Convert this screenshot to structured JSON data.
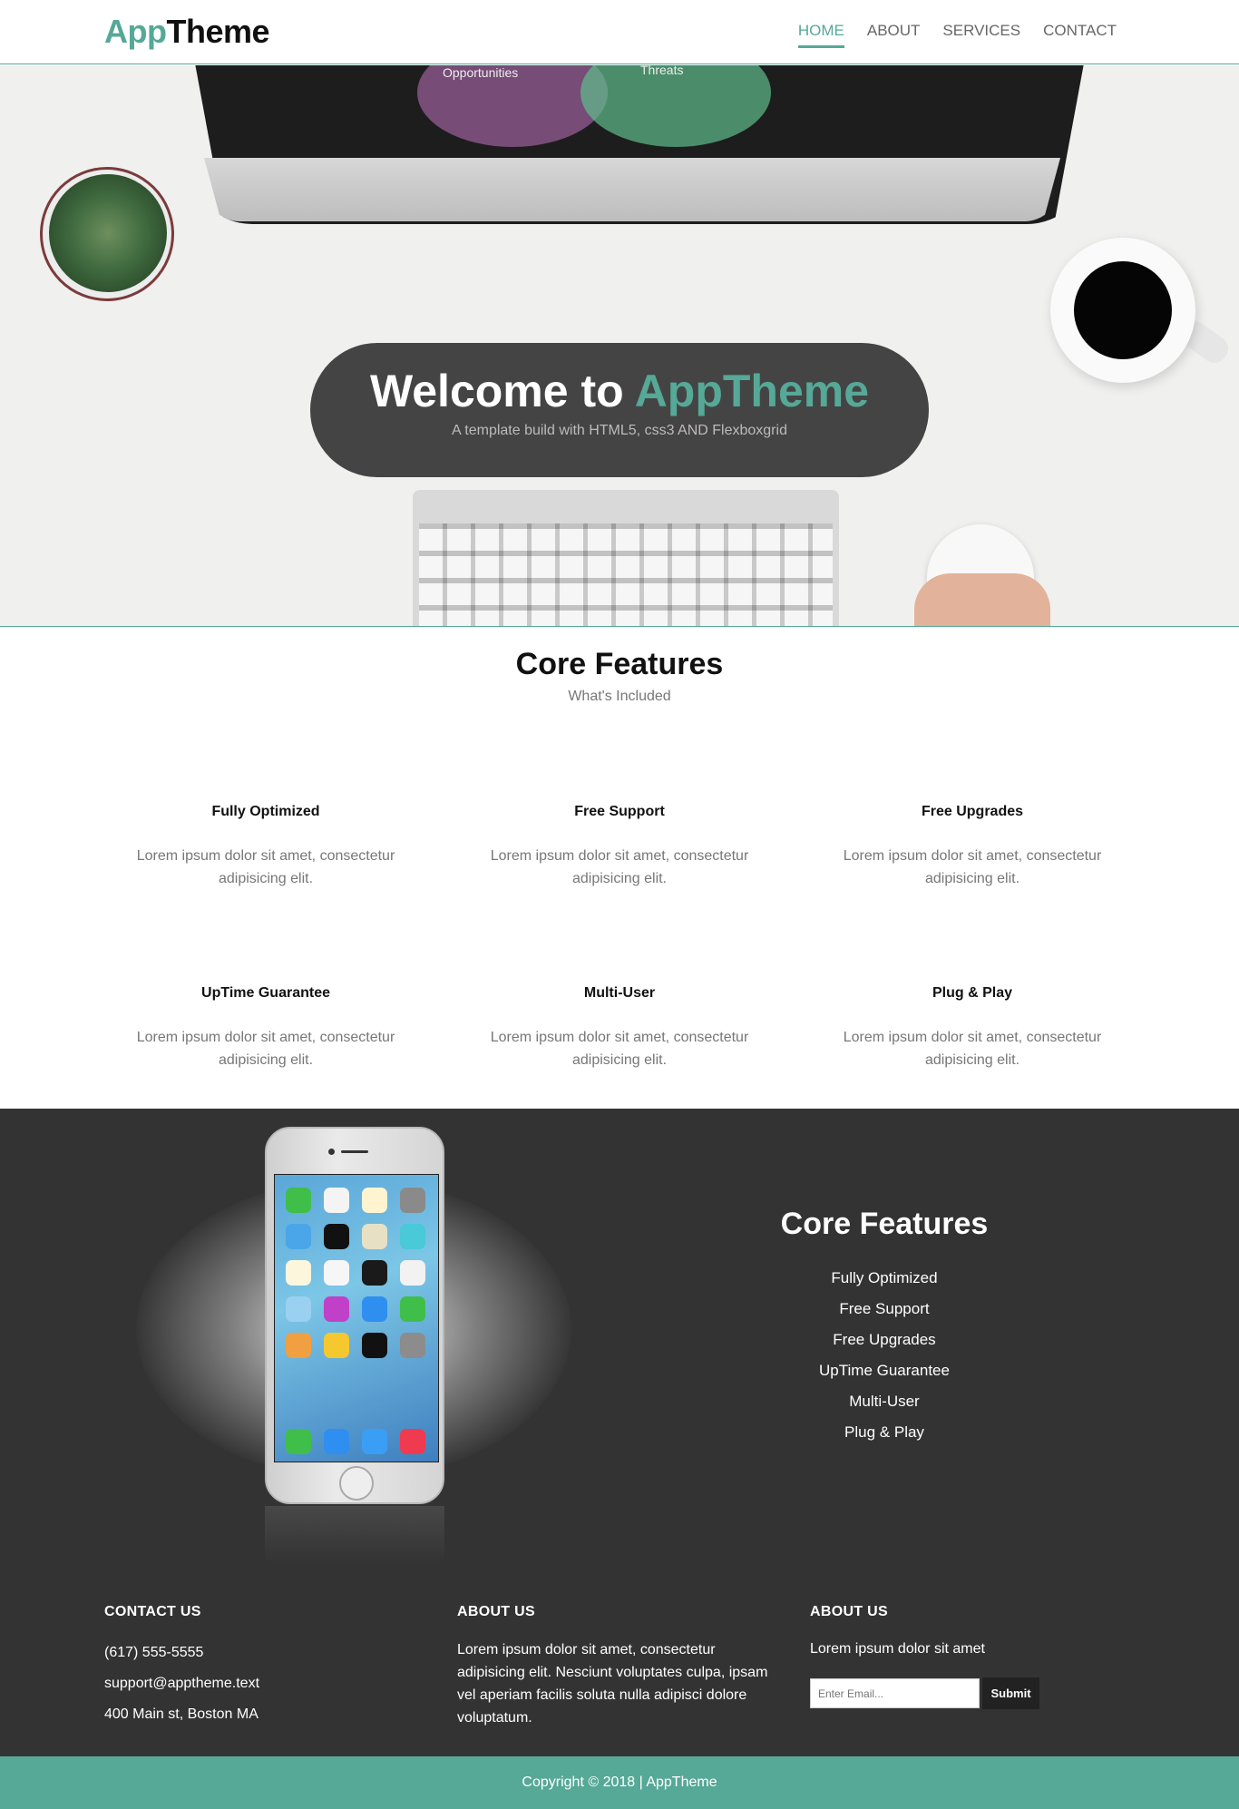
{
  "brand": {
    "part1": "App",
    "part2": "Theme"
  },
  "nav": {
    "items": [
      {
        "label": "HOME",
        "active": true
      },
      {
        "label": "ABOUT",
        "active": false
      },
      {
        "label": "SERVICES",
        "active": false
      },
      {
        "label": "CONTACT",
        "active": false
      }
    ]
  },
  "hero": {
    "title_prefix": "Welcome to",
    "title_accent": "AppTheme",
    "subtitle": "A template build with HTML5, css3 AND Flexboxgrid",
    "image_labels": [
      "Opportunities",
      "Threats"
    ]
  },
  "features": {
    "title": "Core Features",
    "subtitle": "What's Included",
    "items": [
      {
        "title": "Fully Optimized",
        "text": "Lorem ipsum dolor sit amet, consectetur adipisicing elit."
      },
      {
        "title": "Free Support",
        "text": "Lorem ipsum dolor sit amet, consectetur adipisicing elit."
      },
      {
        "title": "Free Upgrades",
        "text": "Lorem ipsum dolor sit amet, consectetur adipisicing elit."
      },
      {
        "title": "UpTime Guarantee",
        "text": "Lorem ipsum dolor sit amet, consectetur adipisicing elit."
      },
      {
        "title": "Multi-User",
        "text": "Lorem ipsum dolor sit amet, consectetur adipisicing elit."
      },
      {
        "title": "Plug & Play",
        "text": "Lorem ipsum dolor sit amet, consectetur adipisicing elit."
      }
    ]
  },
  "showcase": {
    "title": "Core Features",
    "list": [
      "Fully Optimized",
      "Free Support",
      "Free Upgrades",
      "UpTime Guarantee",
      "Multi-User",
      "Plug & Play"
    ]
  },
  "contact": {
    "title": "CONTACT US",
    "phone": "(617) 555-5555",
    "email": "support@apptheme.text",
    "address": "400 Main st, Boston MA"
  },
  "about": {
    "title": "ABOUT US",
    "text": "Lorem ipsum dolor sit amet, consectetur adipisicing elit. Nesciunt voluptates culpa, ipsam vel aperiam facilis soluta nulla adipisci dolore voluptatum."
  },
  "newsletter": {
    "title": "ABOUT US",
    "text": "Lorem ipsum dolor sit amet",
    "placeholder": "Enter Email...",
    "submit_label": "Submit"
  },
  "footer": {
    "copyright": "Copyright © 2018 | AppTheme"
  },
  "colors": {
    "accent": "#56a897",
    "dark": "#333333",
    "badge": "#444445"
  }
}
